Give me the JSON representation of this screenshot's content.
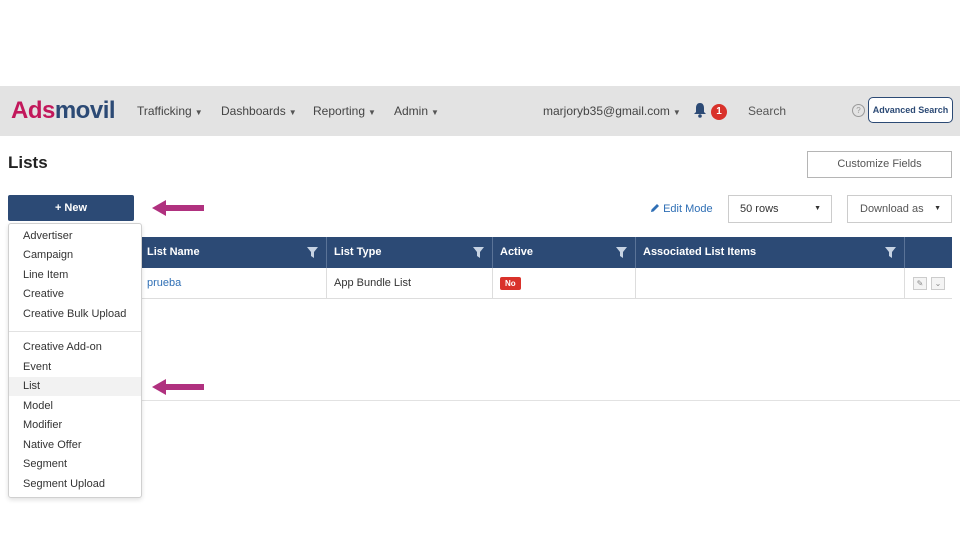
{
  "nav": {
    "logo_part1": "Ads",
    "logo_part2": "movil",
    "menu": [
      "Trafficking",
      "Dashboards",
      "Reporting",
      "Admin"
    ],
    "user_email": "marjoryb35@gmail.com",
    "notification_count": "1",
    "search_label": "Search",
    "help_symbol": "?",
    "advanced_search": "Advanced Search"
  },
  "page": {
    "title": "Lists",
    "customize_fields": "Customize Fields",
    "new_button": "+ New",
    "edit_mode": "Edit Mode",
    "rows_per_page": "50 rows",
    "download_as": "Download as"
  },
  "table": {
    "columns": [
      "List Name",
      "List Type",
      "Active",
      "Associated List Items"
    ],
    "rows": [
      {
        "list_name": "prueba",
        "list_type": "App Bundle List",
        "active": "No",
        "associated_items": ""
      }
    ]
  },
  "new_menu": {
    "group1": [
      "Advertiser",
      "Campaign",
      "Line Item",
      "Creative",
      "Creative Bulk Upload"
    ],
    "group2": [
      "Creative Add-on",
      "Event",
      "List",
      "Model",
      "Modifier",
      "Native Offer",
      "Segment",
      "Segment Upload"
    ],
    "highlighted": "List"
  },
  "colors": {
    "brand_navy": "#2c4a75",
    "brand_magenta": "#c2185b",
    "arrow_annotation": "#b0317f",
    "danger_red": "#d9322b",
    "link_blue": "#2f6fb5"
  },
  "icons": [
    "caret-down-icon",
    "bell-icon",
    "help-icon",
    "pencil-icon",
    "filter-icon",
    "chevron-down-icon",
    "arrow-left-icon"
  ]
}
